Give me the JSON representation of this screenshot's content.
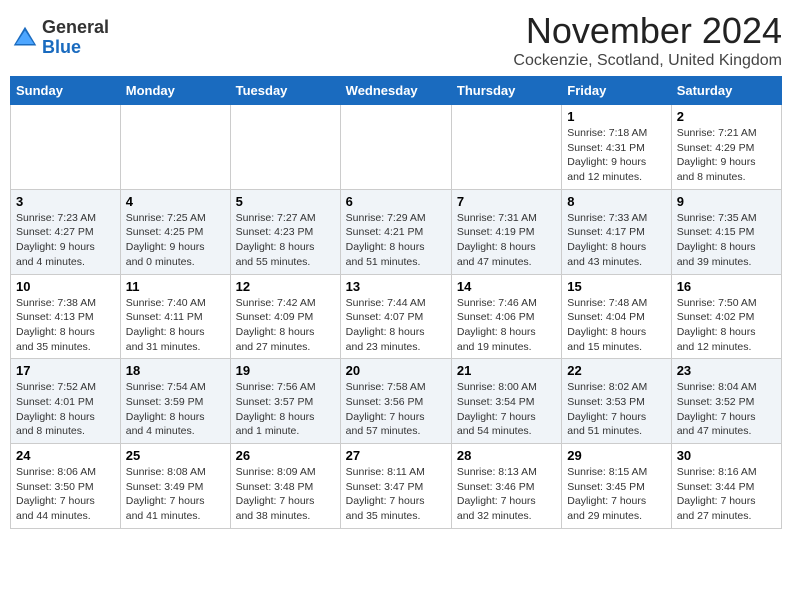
{
  "header": {
    "logo_general": "General",
    "logo_blue": "Blue",
    "month_title": "November 2024",
    "location": "Cockenzie, Scotland, United Kingdom"
  },
  "weekdays": [
    "Sunday",
    "Monday",
    "Tuesday",
    "Wednesday",
    "Thursday",
    "Friday",
    "Saturday"
  ],
  "weeks": [
    [
      {
        "day": "",
        "info": ""
      },
      {
        "day": "",
        "info": ""
      },
      {
        "day": "",
        "info": ""
      },
      {
        "day": "",
        "info": ""
      },
      {
        "day": "",
        "info": ""
      },
      {
        "day": "1",
        "info": "Sunrise: 7:18 AM\nSunset: 4:31 PM\nDaylight: 9 hours\nand 12 minutes."
      },
      {
        "day": "2",
        "info": "Sunrise: 7:21 AM\nSunset: 4:29 PM\nDaylight: 9 hours\nand 8 minutes."
      }
    ],
    [
      {
        "day": "3",
        "info": "Sunrise: 7:23 AM\nSunset: 4:27 PM\nDaylight: 9 hours\nand 4 minutes."
      },
      {
        "day": "4",
        "info": "Sunrise: 7:25 AM\nSunset: 4:25 PM\nDaylight: 9 hours\nand 0 minutes."
      },
      {
        "day": "5",
        "info": "Sunrise: 7:27 AM\nSunset: 4:23 PM\nDaylight: 8 hours\nand 55 minutes."
      },
      {
        "day": "6",
        "info": "Sunrise: 7:29 AM\nSunset: 4:21 PM\nDaylight: 8 hours\nand 51 minutes."
      },
      {
        "day": "7",
        "info": "Sunrise: 7:31 AM\nSunset: 4:19 PM\nDaylight: 8 hours\nand 47 minutes."
      },
      {
        "day": "8",
        "info": "Sunrise: 7:33 AM\nSunset: 4:17 PM\nDaylight: 8 hours\nand 43 minutes."
      },
      {
        "day": "9",
        "info": "Sunrise: 7:35 AM\nSunset: 4:15 PM\nDaylight: 8 hours\nand 39 minutes."
      }
    ],
    [
      {
        "day": "10",
        "info": "Sunrise: 7:38 AM\nSunset: 4:13 PM\nDaylight: 8 hours\nand 35 minutes."
      },
      {
        "day": "11",
        "info": "Sunrise: 7:40 AM\nSunset: 4:11 PM\nDaylight: 8 hours\nand 31 minutes."
      },
      {
        "day": "12",
        "info": "Sunrise: 7:42 AM\nSunset: 4:09 PM\nDaylight: 8 hours\nand 27 minutes."
      },
      {
        "day": "13",
        "info": "Sunrise: 7:44 AM\nSunset: 4:07 PM\nDaylight: 8 hours\nand 23 minutes."
      },
      {
        "day": "14",
        "info": "Sunrise: 7:46 AM\nSunset: 4:06 PM\nDaylight: 8 hours\nand 19 minutes."
      },
      {
        "day": "15",
        "info": "Sunrise: 7:48 AM\nSunset: 4:04 PM\nDaylight: 8 hours\nand 15 minutes."
      },
      {
        "day": "16",
        "info": "Sunrise: 7:50 AM\nSunset: 4:02 PM\nDaylight: 8 hours\nand 12 minutes."
      }
    ],
    [
      {
        "day": "17",
        "info": "Sunrise: 7:52 AM\nSunset: 4:01 PM\nDaylight: 8 hours\nand 8 minutes."
      },
      {
        "day": "18",
        "info": "Sunrise: 7:54 AM\nSunset: 3:59 PM\nDaylight: 8 hours\nand 4 minutes."
      },
      {
        "day": "19",
        "info": "Sunrise: 7:56 AM\nSunset: 3:57 PM\nDaylight: 8 hours\nand 1 minute."
      },
      {
        "day": "20",
        "info": "Sunrise: 7:58 AM\nSunset: 3:56 PM\nDaylight: 7 hours\nand 57 minutes."
      },
      {
        "day": "21",
        "info": "Sunrise: 8:00 AM\nSunset: 3:54 PM\nDaylight: 7 hours\nand 54 minutes."
      },
      {
        "day": "22",
        "info": "Sunrise: 8:02 AM\nSunset: 3:53 PM\nDaylight: 7 hours\nand 51 minutes."
      },
      {
        "day": "23",
        "info": "Sunrise: 8:04 AM\nSunset: 3:52 PM\nDaylight: 7 hours\nand 47 minutes."
      }
    ],
    [
      {
        "day": "24",
        "info": "Sunrise: 8:06 AM\nSunset: 3:50 PM\nDaylight: 7 hours\nand 44 minutes."
      },
      {
        "day": "25",
        "info": "Sunrise: 8:08 AM\nSunset: 3:49 PM\nDaylight: 7 hours\nand 41 minutes."
      },
      {
        "day": "26",
        "info": "Sunrise: 8:09 AM\nSunset: 3:48 PM\nDaylight: 7 hours\nand 38 minutes."
      },
      {
        "day": "27",
        "info": "Sunrise: 8:11 AM\nSunset: 3:47 PM\nDaylight: 7 hours\nand 35 minutes."
      },
      {
        "day": "28",
        "info": "Sunrise: 8:13 AM\nSunset: 3:46 PM\nDaylight: 7 hours\nand 32 minutes."
      },
      {
        "day": "29",
        "info": "Sunrise: 8:15 AM\nSunset: 3:45 PM\nDaylight: 7 hours\nand 29 minutes."
      },
      {
        "day": "30",
        "info": "Sunrise: 8:16 AM\nSunset: 3:44 PM\nDaylight: 7 hours\nand 27 minutes."
      }
    ]
  ]
}
